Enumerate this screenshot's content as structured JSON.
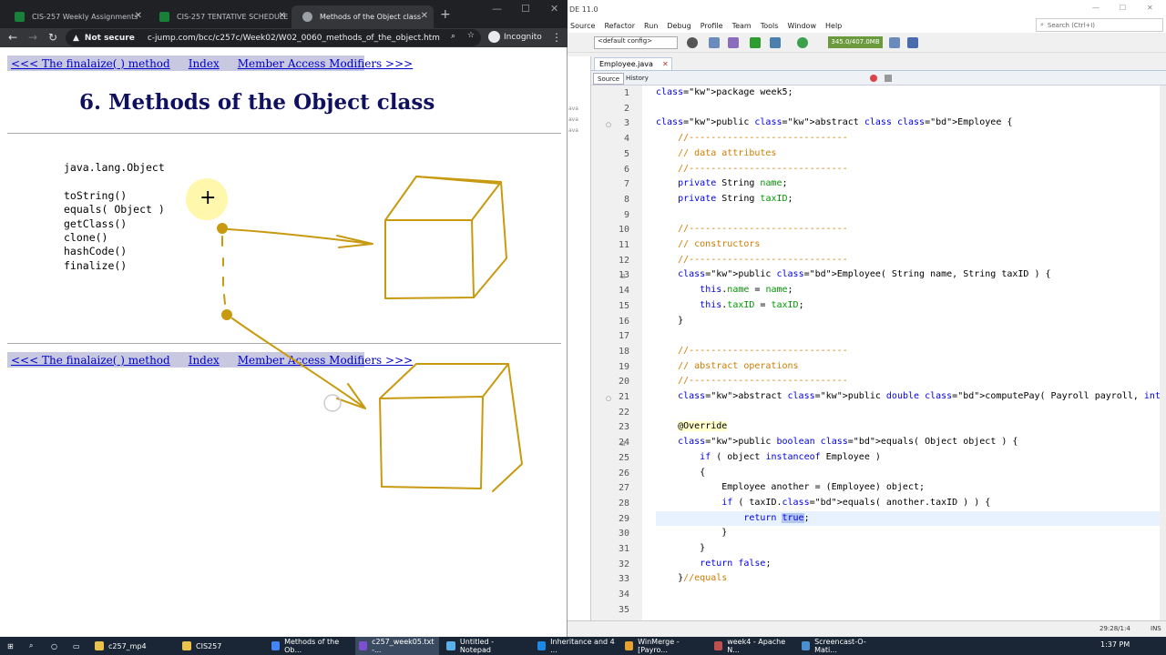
{
  "browser": {
    "tabs": [
      {
        "label": "CIS-257 Weekly Assignments",
        "color": "#188038"
      },
      {
        "label": "CIS-257 TENTATIVE SCHEDULE",
        "color": "#188038"
      },
      {
        "label": "Methods of the Object class",
        "color": "#9aa0a6"
      }
    ],
    "security": "Not secure",
    "url": "c-jump.com/bcc/c257c/Week02/W02_0060_methods_of_the_object.htm",
    "incognito": "Incognito"
  },
  "page": {
    "nav": {
      "prev": "<<< The finalaize( ) method",
      "index": "Index",
      "next": "Member Access Modifiers >>>"
    },
    "title": "6. Methods of the Object class",
    "code_lines": [
      "java.lang.Object",
      "",
      "toString()",
      "equals( Object )",
      "getClass()",
      "clone()",
      "hashCode()",
      "finalize()"
    ],
    "colors": {
      "drawing": "#c89a10",
      "nav_bg": "#c8c8e0",
      "title": "#101060"
    }
  },
  "ide": {
    "title": "DE 11.0",
    "menu": [
      "Source",
      "Refactor",
      "Run",
      "Debug",
      "Profile",
      "Team",
      "Tools",
      "Window",
      "Help"
    ],
    "search_placeholder": "Search (Ctrl+I)",
    "config": "<default config>",
    "memory": "345.0/407.0MB",
    "file_tab": "Employee.java",
    "editor_tabs": [
      "Source",
      "History"
    ],
    "project_strip": [
      "ava",
      "ava",
      "ava"
    ],
    "status": "29:28/1:4",
    "status_mode": "INS",
    "lines": [
      {
        "n": "1",
        "text": "package week5;"
      },
      {
        "n": "2",
        "text": ""
      },
      {
        "n": "3",
        "text": "public abstract class Employee {"
      },
      {
        "n": "4",
        "text": "    //-----------------------------"
      },
      {
        "n": "5",
        "text": "    // data attributes"
      },
      {
        "n": "6",
        "text": "    //-----------------------------"
      },
      {
        "n": "7",
        "text": "    private String name;"
      },
      {
        "n": "8",
        "text": "    private String taxID;"
      },
      {
        "n": "9",
        "text": ""
      },
      {
        "n": "10",
        "text": "    //-----------------------------"
      },
      {
        "n": "11",
        "text": "    // constructors"
      },
      {
        "n": "12",
        "text": "    //-----------------------------"
      },
      {
        "n": "13",
        "text": "    public Employee( String name, String taxID ) {"
      },
      {
        "n": "14",
        "text": "        this.name = name;"
      },
      {
        "n": "15",
        "text": "        this.taxID = taxID;"
      },
      {
        "n": "16",
        "text": "    }"
      },
      {
        "n": "17",
        "text": ""
      },
      {
        "n": "18",
        "text": "    //-----------------------------"
      },
      {
        "n": "19",
        "text": "    // abstract operations"
      },
      {
        "n": "20",
        "text": "    //-----------------------------"
      },
      {
        "n": "21",
        "text": "    abstract public double computePay( Payroll payroll, int hoursWorked );"
      },
      {
        "n": "22",
        "text": ""
      },
      {
        "n": "23",
        "text": "    @Override"
      },
      {
        "n": "24",
        "text": "    public boolean equals( Object object ) {"
      },
      {
        "n": "25",
        "text": "        if ( object instanceof Employee )"
      },
      {
        "n": "26",
        "text": "        {"
      },
      {
        "n": "27",
        "text": "            Employee another = (Employee) object;"
      },
      {
        "n": "28",
        "text": "            if ( taxID.equals( another.taxID ) ) {"
      },
      {
        "n": "29",
        "text": "                return true;"
      },
      {
        "n": "30",
        "text": "            }"
      },
      {
        "n": "31",
        "text": "        }"
      },
      {
        "n": "32",
        "text": "        return false;"
      },
      {
        "n": "33",
        "text": "    }//equals"
      },
      {
        "n": "34",
        "text": ""
      },
      {
        "n": "35",
        "text": ""
      }
    ]
  },
  "taskbar": {
    "items": [
      {
        "label": "c257_mp4",
        "color": "#e8c24a"
      },
      {
        "label": "CIS257",
        "color": "#e8c24a"
      },
      {
        "label": "Methods of the Ob...",
        "color": "#4285f4"
      },
      {
        "label": "c257_week05.txt -...",
        "color": "#7b4fd0"
      },
      {
        "label": "Untitled - Notepad",
        "color": "#5ab0e8"
      },
      {
        "label": "Inheritance and 4 ...",
        "color": "#1e88e5"
      },
      {
        "label": "WinMerge - [Payro...",
        "color": "#e8a030"
      },
      {
        "label": "week4 - Apache N...",
        "color": "#c05050"
      },
      {
        "label": "Screencast-O-Mati...",
        "color": "#4a90d0"
      }
    ],
    "time": "1:37 PM"
  }
}
